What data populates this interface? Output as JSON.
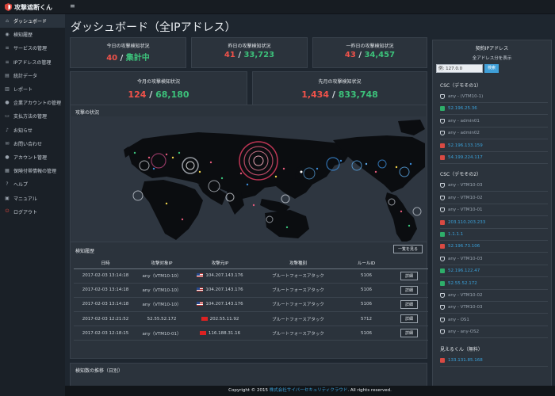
{
  "brand": {
    "name": "攻撃遮断くん"
  },
  "sidebar": {
    "items": [
      {
        "label": "ダッシュボード",
        "icon": "dashboard-icon",
        "glyph": "⌂"
      },
      {
        "label": "検知履歴",
        "icon": "eye-icon",
        "glyph": "◉"
      },
      {
        "label": "サービスの管理",
        "icon": "list-icon",
        "glyph": "≡"
      },
      {
        "label": "IPアドレスの管理",
        "icon": "list-icon",
        "glyph": "≡"
      },
      {
        "label": "統計データ",
        "icon": "chart-icon",
        "glyph": "▤"
      },
      {
        "label": "レポート",
        "icon": "report-icon",
        "glyph": "▥"
      },
      {
        "label": "企業アカウントの管理",
        "icon": "user-icon",
        "glyph": "●"
      },
      {
        "label": "支払方法の管理",
        "icon": "card-icon",
        "glyph": "▭"
      },
      {
        "label": "お知らせ",
        "icon": "bell-icon",
        "glyph": "♪"
      },
      {
        "label": "お問い合わせ",
        "icon": "mail-icon",
        "glyph": "✉"
      },
      {
        "label": "アカウント管理",
        "icon": "user-icon",
        "glyph": "●"
      },
      {
        "label": "保険付帯情報の管理",
        "icon": "doc-icon",
        "glyph": "▦"
      },
      {
        "label": "ヘルプ",
        "icon": "help-icon",
        "glyph": "?"
      },
      {
        "label": "マニュアル",
        "icon": "book-icon",
        "glyph": "▣"
      },
      {
        "label": "ログアウト",
        "icon": "power-icon",
        "glyph": "⏻"
      }
    ]
  },
  "page": {
    "title": "ダッシュボード（全IPアドレス）"
  },
  "stats": {
    "today": {
      "label": "今日の攻撃検知状況",
      "red": "40",
      "green": "集計中"
    },
    "yesterday": {
      "label": "昨日の攻撃検知状況",
      "red": "41",
      "green": "33,723"
    },
    "dayBefore": {
      "label": "一昨日の攻撃検知状況",
      "red": "43",
      "green": "34,457"
    },
    "month": {
      "label": "今月の攻撃検知状況",
      "red": "124",
      "green": "68,180"
    },
    "lastMonth": {
      "label": "先月の攻撃検知状況",
      "red": "1,434",
      "green": "833,748"
    }
  },
  "map": {
    "title": "攻撃の状況"
  },
  "history": {
    "title": "検知履歴",
    "list_button": "一覧を見る",
    "columns": [
      "日時",
      "攻撃対象IP",
      "攻撃元IP",
      "攻撃種別",
      "ルールID",
      ""
    ],
    "rows": [
      {
        "date": "2017-02-03 13:14:18",
        "target": "any（VTM10-10）",
        "source": "104.207.143.176",
        "flag": "us",
        "type": "ブルートフォースアタック",
        "rule": "5106",
        "action": "詳細"
      },
      {
        "date": "2017-02-03 13:14:18",
        "target": "any（VTM10-10）",
        "source": "104.207.143.176",
        "flag": "us",
        "type": "ブルートフォースアタック",
        "rule": "5106",
        "action": "詳細"
      },
      {
        "date": "2017-02-03 13:14:18",
        "target": "any（VTM10-10）",
        "source": "104.207.143.176",
        "flag": "us",
        "type": "ブルートフォースアタック",
        "rule": "5106",
        "action": "詳細"
      },
      {
        "date": "2017-02-03 12:21:52",
        "target": "52.55.52.172",
        "source": "202.55.11.92",
        "flag": "cn",
        "type": "ブルートフォースアタック",
        "rule": "5712",
        "action": "詳細"
      },
      {
        "date": "2017-02-03 12:18:15",
        "target": "any（VTM10-01）",
        "source": "116.188.31.16",
        "flag": "cn",
        "type": "ブルートフォースアタック",
        "rule": "5106",
        "action": "詳細"
      }
    ]
  },
  "trend": {
    "title": "検知数の推移（日別）"
  },
  "ipPanel": {
    "title": "契約IPアドレス",
    "subtitle": "全アドレス分を表示",
    "input_value": "例: 127.0.0",
    "button": "検索",
    "groups": [
      {
        "label": "CSC（デモその1）",
        "rows": [
          {
            "kind": "shield",
            "text": "any - (VTM10-1)"
          },
          {
            "kind": "green",
            "text": "52.196.25.36"
          },
          {
            "kind": "shield",
            "text": "any - admin01"
          },
          {
            "kind": "shield",
            "text": "any - admin02"
          },
          {
            "kind": "red",
            "text": "52.196.133.159"
          },
          {
            "kind": "red",
            "text": "54.199.224.117"
          }
        ]
      },
      {
        "label": "CSC（デモその2）",
        "rows": [
          {
            "kind": "shield",
            "text": "any - VTM10-03"
          },
          {
            "kind": "shield",
            "text": "any - VTM10-02"
          },
          {
            "kind": "shield",
            "text": "any - VTM10-01"
          },
          {
            "kind": "red",
            "text": "203.110.203.233"
          },
          {
            "kind": "green",
            "text": "1.1.1.1"
          },
          {
            "kind": "red",
            "text": "52.196.73.106"
          },
          {
            "kind": "shield",
            "text": "any - VTM10-03"
          },
          {
            "kind": "green",
            "text": "52.196.122.47"
          },
          {
            "kind": "green",
            "text": "52.55.52.172"
          },
          {
            "kind": "shield",
            "text": "any - VTM10-02"
          },
          {
            "kind": "shield",
            "text": "any - VTM10-03"
          },
          {
            "kind": "shield",
            "text": "any - OS1"
          },
          {
            "kind": "shield",
            "text": "any - any-OS2"
          }
        ]
      },
      {
        "label": "見えるくん（無料）",
        "rows": [
          {
            "kind": "red",
            "text": "133.131.85.168"
          }
        ]
      }
    ]
  },
  "footer": {
    "prefix": "Copyright © 2015",
    "company": "株式会社サイバーセキュリティクラウド",
    "suffix": ". All rights reserved."
  }
}
